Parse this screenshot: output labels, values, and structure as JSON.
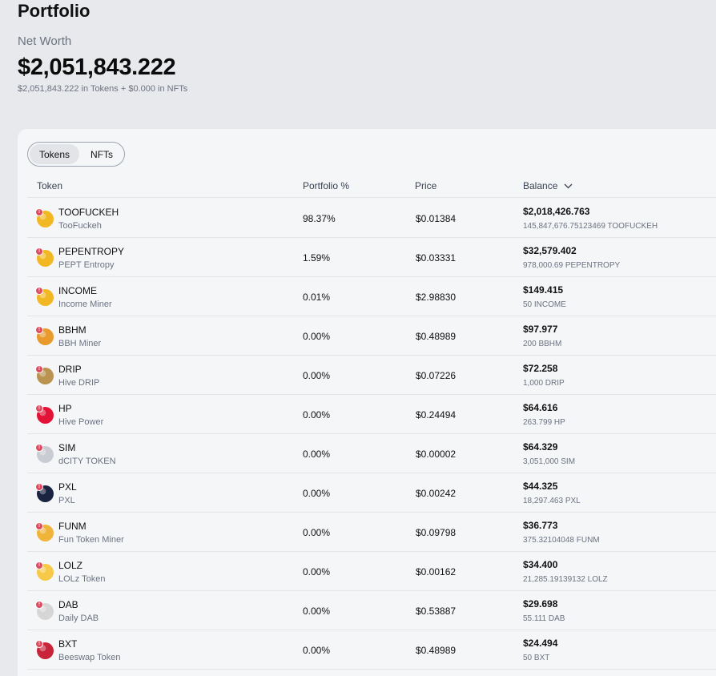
{
  "header": {
    "title": "Portfolio",
    "net_worth_label": "Net Worth",
    "net_worth_value": "$2,051,843.222",
    "net_worth_breakdown": "$2,051,843.222 in Tokens + $0.000 in NFTs"
  },
  "tabs": [
    {
      "label": "Tokens",
      "active": true
    },
    {
      "label": "NFTs",
      "active": false
    }
  ],
  "table": {
    "columns": [
      "Token",
      "Portfolio %",
      "Price",
      "Balance"
    ],
    "sort_icon": "chevron-down-icon",
    "rows": [
      {
        "symbol": "TOOFUCKEH",
        "name": "TooFuckeh",
        "pct": "98.37%",
        "price": "$0.01384",
        "balance": "$2,018,426.763",
        "qty": "145,847,676.75123469 TOOFUCKEH",
        "icon": "coin-icon",
        "color": "#f2b824"
      },
      {
        "symbol": "PEPENTROPY",
        "name": "PEPT Entropy",
        "pct": "1.59%",
        "price": "$0.03331",
        "balance": "$32,579.402",
        "qty": "978,000.69 PEPENTROPY",
        "icon": "coin-icon",
        "color": "#f2b824"
      },
      {
        "symbol": "INCOME",
        "name": "Income Miner",
        "pct": "0.01%",
        "price": "$2.98830",
        "balance": "$149.415",
        "qty": "50 INCOME",
        "icon": "coin-icon",
        "color": "#f2b824"
      },
      {
        "symbol": "BBHM",
        "name": "BBH Miner",
        "pct": "0.00%",
        "price": "$0.48989",
        "balance": "$97.977",
        "qty": "200 BBHM",
        "icon": "miner-icon",
        "color": "#e89a2c"
      },
      {
        "symbol": "DRIP",
        "name": "Hive DRIP",
        "pct": "0.00%",
        "price": "$0.07226",
        "balance": "$72.258",
        "qty": "1,000 DRIP",
        "icon": "drip-icon",
        "color": "#b9934f"
      },
      {
        "symbol": "HP",
        "name": "Hive Power",
        "pct": "0.00%",
        "price": "$0.24494",
        "balance": "$64.616",
        "qty": "263.799 HP",
        "icon": "hive-icon",
        "color": "#e31337"
      },
      {
        "symbol": "SIM",
        "name": "dCITY TOKEN",
        "pct": "0.00%",
        "price": "$0.00002",
        "balance": "$64.329",
        "qty": "3,051,000 SIM",
        "icon": "city-icon",
        "color": "#c9ccd2"
      },
      {
        "symbol": "PXL",
        "name": "PXL",
        "pct": "0.00%",
        "price": "$0.00242",
        "balance": "$44.325",
        "qty": "18,297.463 PXL",
        "icon": "pxl-icon",
        "color": "#1a2340"
      },
      {
        "symbol": "FUNM",
        "name": "Fun Token Miner",
        "pct": "0.00%",
        "price": "$0.09798",
        "balance": "$36.773",
        "qty": "375.32104048 FUNM",
        "icon": "miner-icon",
        "color": "#f0b43a"
      },
      {
        "symbol": "LOLZ",
        "name": "LOLz Token",
        "pct": "0.00%",
        "price": "$0.00162",
        "balance": "$34.400",
        "qty": "21,285.19139132 LOLZ",
        "icon": "laugh-emoji-icon",
        "color": "#f7c948"
      },
      {
        "symbol": "DAB",
        "name": "Daily DAB",
        "pct": "0.00%",
        "price": "$0.53887",
        "balance": "$29.698",
        "qty": "55.111 DAB",
        "icon": "dab-icon",
        "color": "#d6d6d6"
      },
      {
        "symbol": "BXT",
        "name": "Beeswap Token",
        "pct": "0.00%",
        "price": "$0.48989",
        "balance": "$24.494",
        "qty": "50 BXT",
        "icon": "bee-icon",
        "color": "#c8243a"
      }
    ]
  }
}
